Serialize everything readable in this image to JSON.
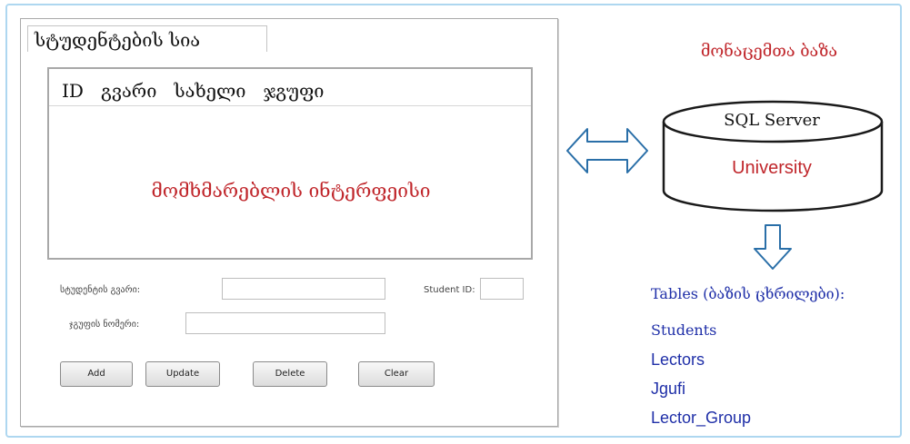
{
  "interface": {
    "window_title": "სტუდენტების სია",
    "list_headers": [
      "ID",
      "გვარი",
      "სახელი",
      "ჯგუფი"
    ],
    "center_label": "მომხმარებლის ინტერფეისი",
    "fields": {
      "student_surname_label": "სტუდენტის გვარი:",
      "student_id_label": "Student ID:",
      "group_number_label": "ჯგუფის ნომერი:"
    },
    "buttons": [
      "Add",
      "Update",
      "Delete",
      "Clear"
    ]
  },
  "database": {
    "title": "მონაცემთა ბაზა",
    "server": "SQL Server",
    "name": "University"
  },
  "tables": {
    "title": "Tables  (ბაზის ცხრილები):",
    "items": [
      "Students",
      "Lectors",
      "Jgufi",
      "Lector_Group"
    ]
  },
  "colors": {
    "red_text": "#c0262b",
    "blue_text": "#1f2fa8",
    "frame_border": "#aed7f0"
  }
}
